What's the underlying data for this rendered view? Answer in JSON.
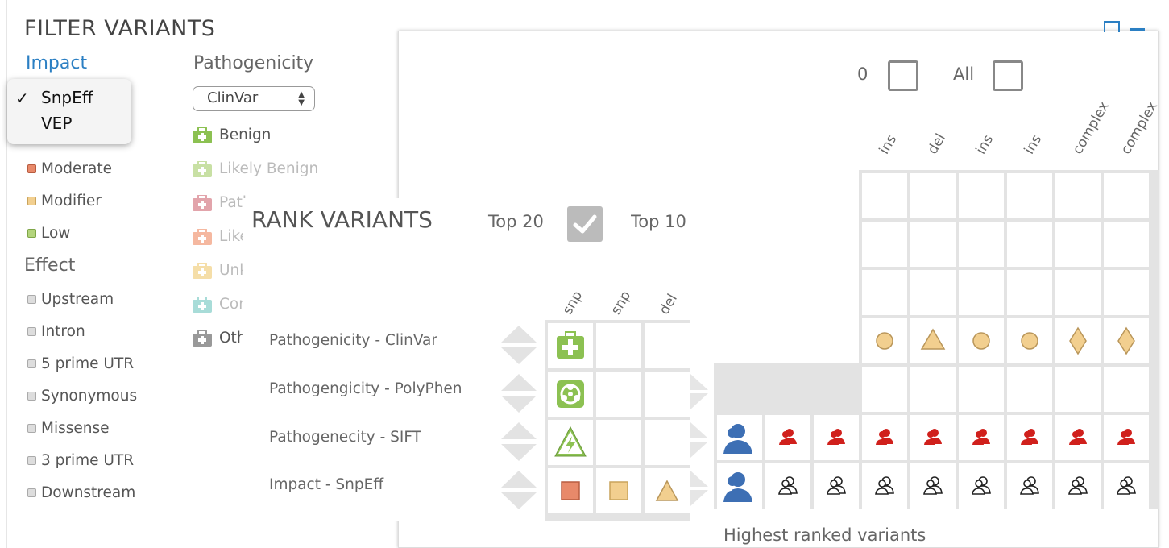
{
  "filter": {
    "title": "FILTER VARIANTS",
    "impact_label": "Impact",
    "pathogenicity_label": "Pathogenicity",
    "select_value": "ClinVar",
    "dropdown_options": [
      "SnpEff",
      "VEP"
    ],
    "impact_items": [
      {
        "label": "Moderate",
        "color": "#e8896a"
      },
      {
        "label": "Modifier",
        "color": "#f2cf8f"
      },
      {
        "label": "Low",
        "color": "#b3d47c"
      }
    ],
    "effect_label": "Effect",
    "effect_items": [
      "Upstream",
      "Intron",
      "5 prime UTR",
      "Synonymous",
      "Missense",
      "3 prime UTR",
      "Downstream"
    ],
    "pathogenicity_items": [
      {
        "label": "Benign",
        "color": "#8cc152"
      },
      {
        "label": "Likely Benign",
        "color": "#c8e0a4"
      },
      {
        "label": "Path",
        "color": "#e2a4ab"
      },
      {
        "label": "Like",
        "color": "#f5b8a0"
      },
      {
        "label": "Unk",
        "color": "#f5dea8"
      },
      {
        "label": "Con",
        "color": "#a8dcd8"
      },
      {
        "label": "Othe",
        "color": "#999999"
      }
    ]
  },
  "back_chart": {
    "top_labels": [
      "0",
      "All"
    ],
    "column_labels": [
      "ins",
      "del",
      "ins",
      "ins",
      "complex",
      "complex"
    ],
    "footer": "Highest ranked variants"
  },
  "rank": {
    "title": "RANK VARIANTS",
    "top20_label": "Top 20",
    "top100_label": "Top 10",
    "column_labels": [
      "snp",
      "snp",
      "del"
    ],
    "rows": [
      "Pathogenicity - ClinVar",
      "Pathogengicity - PolyPhen",
      "Pathogenecity - SIFT",
      "Impact - SnpEff"
    ]
  },
  "icons": {
    "benign": "medkit-icon",
    "polyphen": "biohazard-icon",
    "sift": "lightning-warning-icon",
    "person_big": "person-blue-icon",
    "person_red": "person-red-icon",
    "person_outline": "person-outline-icon"
  }
}
